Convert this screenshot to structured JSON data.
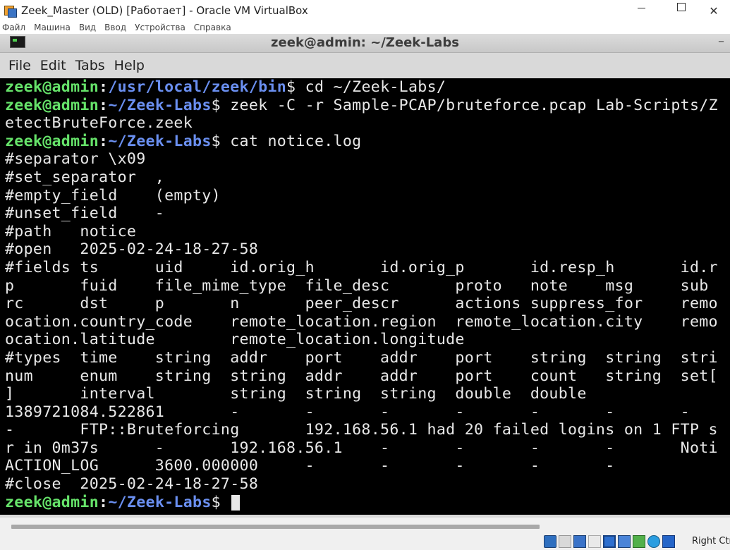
{
  "host_window": {
    "title": "Zeek_Master (OLD) [Работает] - Oracle VM VirtualBox",
    "app_icon": "virtualbox-icon",
    "menu": [
      "Файл",
      "Машина",
      "Вид",
      "Ввод",
      "Устройства",
      "Справка"
    ]
  },
  "terminal_window": {
    "title": "zeek@admin: ~/Zeek-Labs",
    "icon": "terminal-icon",
    "menu": [
      "File",
      "Edit",
      "Tabs",
      "Help"
    ]
  },
  "terminal": {
    "lines": [
      {
        "type": "prompt",
        "user": "zeek@admin",
        "path": "/usr/local/zeek/bin",
        "cmd": " cd ~/Zeek-Labs/"
      },
      {
        "type": "prompt",
        "user": "zeek@admin",
        "path": "~/Zeek-Labs",
        "cmd": " zeek -C -r Sample-PCAP/bruteforce.pcap Lab-Scripts/Z"
      },
      {
        "type": "out",
        "text": "etectBruteForce.zeek"
      },
      {
        "type": "prompt",
        "user": "zeek@admin",
        "path": "~/Zeek-Labs",
        "cmd": " cat notice.log"
      },
      {
        "type": "out",
        "text": "#separator \\x09"
      },
      {
        "type": "out",
        "text": "#set_separator  ,"
      },
      {
        "type": "out",
        "text": "#empty_field    (empty)"
      },
      {
        "type": "out",
        "text": "#unset_field    -"
      },
      {
        "type": "out",
        "text": "#path   notice"
      },
      {
        "type": "out",
        "text": "#open   2025-02-24-18-27-58"
      },
      {
        "type": "out",
        "text": "#fields ts      uid     id.orig_h       id.orig_p       id.resp_h       id.r"
      },
      {
        "type": "out",
        "text": "p       fuid    file_mime_type  file_desc       proto   note    msg     sub"
      },
      {
        "type": "out",
        "text": "rc      dst     p       n       peer_descr      actions suppress_for    remo"
      },
      {
        "type": "out",
        "text": "ocation.country_code    remote_location.region  remote_location.city    remo"
      },
      {
        "type": "out",
        "text": "ocation.latitude        remote_location.longitude"
      },
      {
        "type": "out",
        "text": "#types  time    string  addr    port    addr    port    string  string  stri"
      },
      {
        "type": "out",
        "text": "num     enum    string  string  addr    addr    port    count   string  set["
      },
      {
        "type": "out",
        "text": "]       interval        string  string  string  double  double"
      },
      {
        "type": "out",
        "text": "1389721084.522861       -       -       -       -       -       -       -"
      },
      {
        "type": "out",
        "text": "-       FTP::Bruteforcing       192.168.56.1 had 20 failed logins on 1 FTP s"
      },
      {
        "type": "out",
        "text": "r in 0m37s      -       192.168.56.1    -       -       -       -       Noti"
      },
      {
        "type": "out",
        "text": "ACTION_LOG      3600.000000     -       -       -       -       -"
      },
      {
        "type": "out",
        "text": "#close  2025-02-24-18-27-58"
      },
      {
        "type": "prompt",
        "user": "zeek@admin",
        "path": "~/Zeek-Labs",
        "cmd": " ",
        "cursor": true
      }
    ]
  },
  "statusbar": {
    "host_key": "Right Ctrl",
    "icons": [
      "hard-disk-icon",
      "optical-drive-icon",
      "audio-icon",
      "network-icon",
      "usb-icon",
      "shared-folders-icon",
      "display-icon",
      "recording-icon",
      "mouse-integration-icon"
    ]
  },
  "colors": {
    "terminal_bg": "#000000",
    "terminal_fg": "#e8e8e8",
    "prompt_user": "#66e36a",
    "prompt_path": "#6a8ff0"
  }
}
